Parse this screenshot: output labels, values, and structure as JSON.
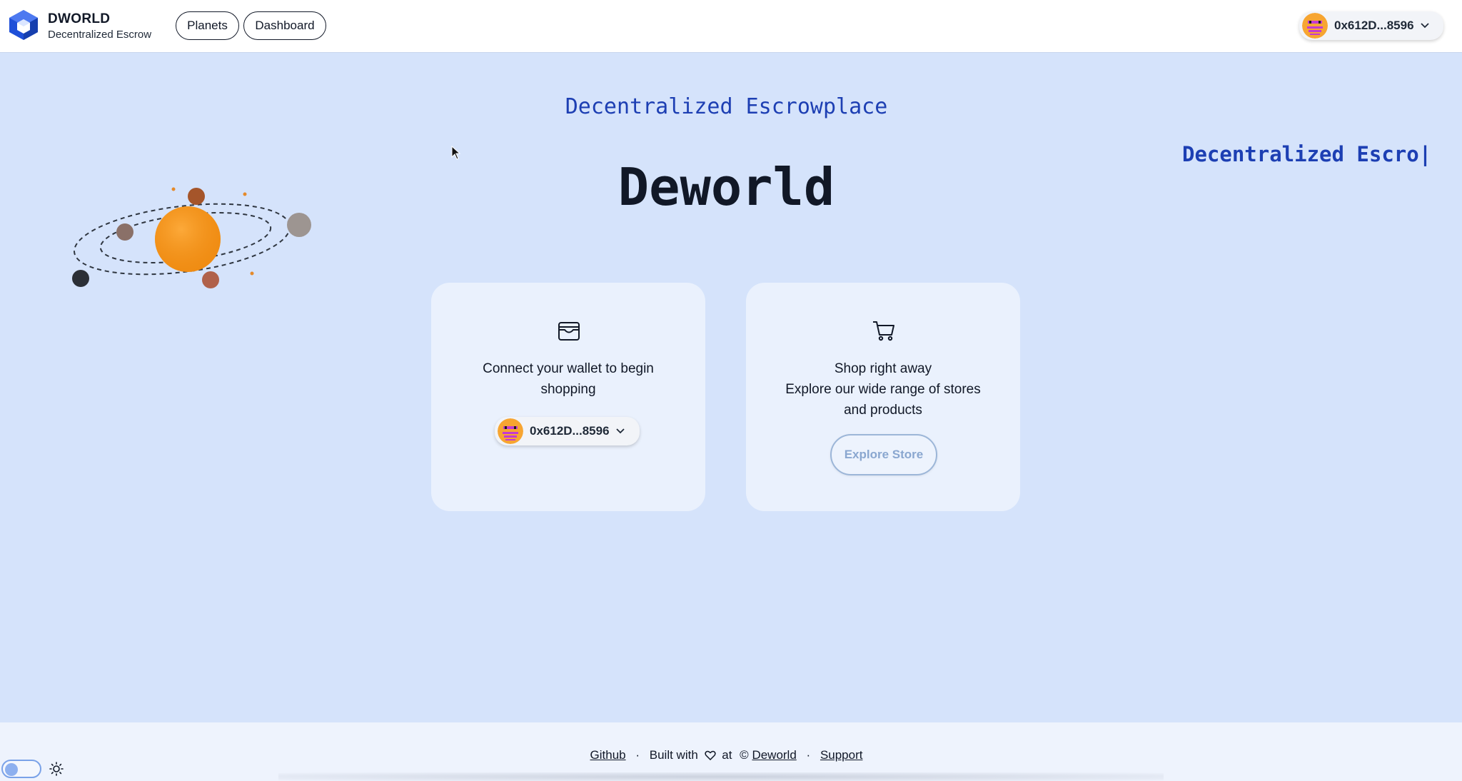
{
  "header": {
    "brand_title": "DWORLD",
    "brand_subtitle": "Decentralized Escrow",
    "nav": {
      "planets": "Planets",
      "dashboard": "Dashboard"
    },
    "wallet_address": "0x612D...8596"
  },
  "hero": {
    "subtitle": "Decentralized Escrowplace",
    "typing_text": "Decentralized Escro|",
    "title": "Deworld"
  },
  "cards": {
    "wallet": {
      "text": "Connect your wallet to begin shopping",
      "wallet_address": "0x612D...8596"
    },
    "shop": {
      "line1": "Shop right away",
      "line2": "Explore our wide range of stores and products",
      "button": "Explore Store"
    }
  },
  "footer": {
    "github": "Github",
    "built_with": "Built with",
    "at": "at",
    "copyright": "©",
    "deworld": "Deworld",
    "support": "Support",
    "separator": "·"
  },
  "colors": {
    "accent_blue": "#1d3fb3",
    "page_bg": "#d5e3fb",
    "card_bg": "#eaf1fd",
    "logo_blue": "#1e4fd8"
  },
  "icons": [
    "cube-logo-icon",
    "chevron-down-icon",
    "wallet-icon",
    "cart-icon",
    "heart-icon",
    "sun-icon"
  ]
}
